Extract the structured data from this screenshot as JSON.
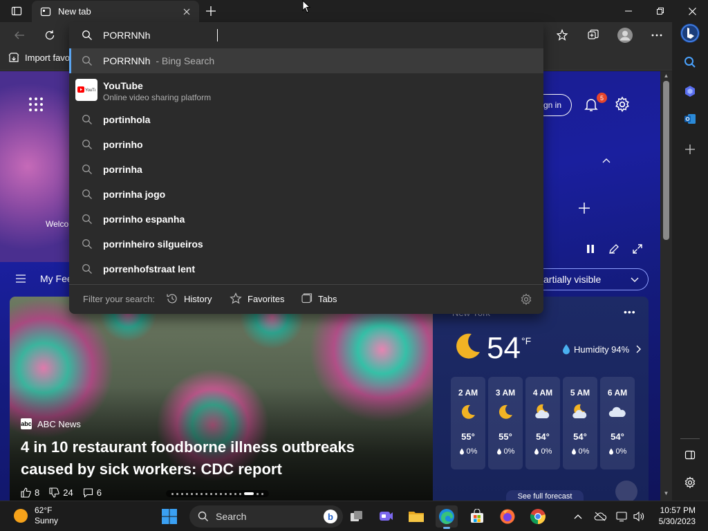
{
  "browser": {
    "tab": {
      "title": "New tab"
    },
    "favorites_bar": {
      "import_label": "Import favo"
    }
  },
  "omnibox": {
    "query": "PORRNNh",
    "suggestions": [
      {
        "text": "PORRNNh",
        "suffix": "- Bing Search",
        "type": "search"
      },
      {
        "title": "YouTube",
        "subtitle": "Online video sharing platform",
        "type": "site"
      },
      {
        "text": "portinhola",
        "type": "search"
      },
      {
        "text": "porrinho",
        "type": "search"
      },
      {
        "text": "porrinha",
        "type": "search"
      },
      {
        "text": "porrinha jogo",
        "type": "search"
      },
      {
        "text": "porrinho espanha",
        "type": "search"
      },
      {
        "text": "porrinheiro silgueiros",
        "type": "search"
      },
      {
        "text": "porrenhofstraat lent",
        "type": "search"
      }
    ],
    "footer": {
      "filter_label": "Filter your search:",
      "history_label": "History",
      "favorites_label": "Favorites",
      "tabs_label": "Tabs"
    }
  },
  "newtab": {
    "welcome_label": "Welco",
    "signin_label": "gn in",
    "notification_count": "5",
    "feed_label": "My Fee",
    "content_visibility": "artially visible",
    "news": {
      "source": "ABC News",
      "headline": "4 in 10 restaurant foodborne illness outbreaks caused by sick workers: CDC report",
      "likes": "8",
      "dislikes": "24",
      "comments": "6"
    },
    "weather": {
      "city": "New York",
      "temp": "54",
      "unit": "°F",
      "humidity": "Humidity 94%",
      "hours": [
        {
          "time": "2 AM",
          "icon": "moon-icon",
          "temp": "55°",
          "precip": "0%"
        },
        {
          "time": "3 AM",
          "icon": "moon-icon",
          "temp": "55°",
          "precip": "0%"
        },
        {
          "time": "4 AM",
          "icon": "moon-cloud-icon",
          "temp": "54°",
          "precip": "0%"
        },
        {
          "time": "5 AM",
          "icon": "moon-cloud-icon",
          "temp": "54°",
          "precip": "0%"
        },
        {
          "time": "6 AM",
          "icon": "cloud-icon",
          "temp": "54°",
          "precip": "0%"
        }
      ],
      "forecast_label": "See full forecast"
    }
  },
  "taskbar": {
    "weather": {
      "temp": "62°F",
      "condition": "Sunny"
    },
    "search_label": "Search",
    "clock": {
      "time": "10:57 PM",
      "date": "5/30/2023"
    }
  },
  "colors": {
    "accent": "#5aa4f0",
    "page_bg": "#1a1f9e",
    "badge": "#e5452d"
  }
}
